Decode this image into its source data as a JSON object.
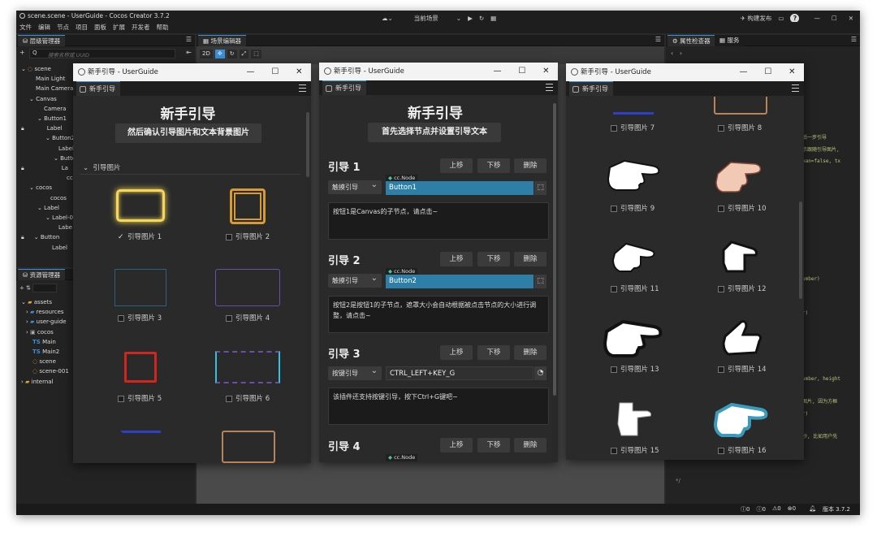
{
  "app": {
    "title": "scene.scene - UserGuide - Cocos Creator 3.7.2",
    "menu": [
      "文件",
      "编辑",
      "节点",
      "项目",
      "面板",
      "扩展",
      "开发者",
      "帮助"
    ],
    "scene_select": "当前场景",
    "build_publish": "构建发布",
    "version": "版本 3.7.2",
    "status_counts": [
      "0",
      "0",
      "0",
      "0"
    ]
  },
  "hierarchy": {
    "tab": "层级管理器",
    "search_placeholder": "搜索名称或 UUID",
    "nodes": [
      "scene",
      "Main Light",
      "Main Camera",
      "Canvas",
      "Camera",
      "Button1",
      "Label",
      "Button2",
      "Label",
      "Butto",
      "La",
      "cc",
      "cocos",
      "cocos",
      "Label",
      "Label-00",
      "Labe",
      "Button",
      "Label"
    ]
  },
  "assets": {
    "tab": "资源管理器",
    "items": [
      "assets",
      "resources",
      "user-guide",
      "cocos",
      "Main",
      "Main2",
      "scene",
      "scene-001",
      "internal"
    ]
  },
  "scene_editor": {
    "tab": "场景编辑器",
    "mode": "2D"
  },
  "inspector": {
    "tabs": [
      "属性检查器",
      "服务"
    ],
    "code_lines": [
      "后一步引导",
      "示跟随引导图片,",
      "ean=false, tx",
      "umber)",
      "r)",
      "umber, height",
      "图片, 因为方框",
      "r)",
      "秒, 比如用户先"
    ]
  },
  "win_left": {
    "title": "新手引导 - UserGuide",
    "tab": "新手引导",
    "heading": "新手引导",
    "subtitle": "然后确认引导图片和文本背景图片",
    "section": "引导图片",
    "items": [
      "引导图片 1",
      "引导图片 2",
      "引导图片 3",
      "引导图片 4",
      "引导图片 5",
      "引导图片 6"
    ]
  },
  "win_mid": {
    "title": "新手引导 - UserGuide",
    "tab": "新手引导",
    "heading": "新手引导",
    "subtitle": "首先选择节点并设置引导文本",
    "btn_up": "上移",
    "btn_down": "下移",
    "btn_del": "删除",
    "node_tag": "cc.Node",
    "guides": [
      {
        "name": "引导 1",
        "trigger": "触摸引导",
        "target": "Button1",
        "text": "按钮1是Canvas的子节点，请点击~"
      },
      {
        "name": "引导 2",
        "trigger": "触摸引导",
        "target": "Button2",
        "text": "按钮2是按钮1的子节点，遮罩大小会自动根据被点击节点的大小进行调整，请点击~"
      },
      {
        "name": "引导 3",
        "trigger": "按键引导",
        "target": "CTRL_LEFT+KEY_G",
        "text": "该插件还支持按键引导，按下Ctrl+G键吧~"
      },
      {
        "name": "引导 4",
        "trigger": "",
        "target": "",
        "text": ""
      }
    ]
  },
  "win_right": {
    "title": "新手引导 - UserGuide",
    "tab": "新手引导",
    "items": [
      "引导图片 7",
      "引导图片 8",
      "引导图片 9",
      "引导图片 10",
      "引导图片 11",
      "引导图片 12",
      "引导图片 13",
      "引导图片 14",
      "引导图片 15",
      "引导图片 16"
    ]
  }
}
